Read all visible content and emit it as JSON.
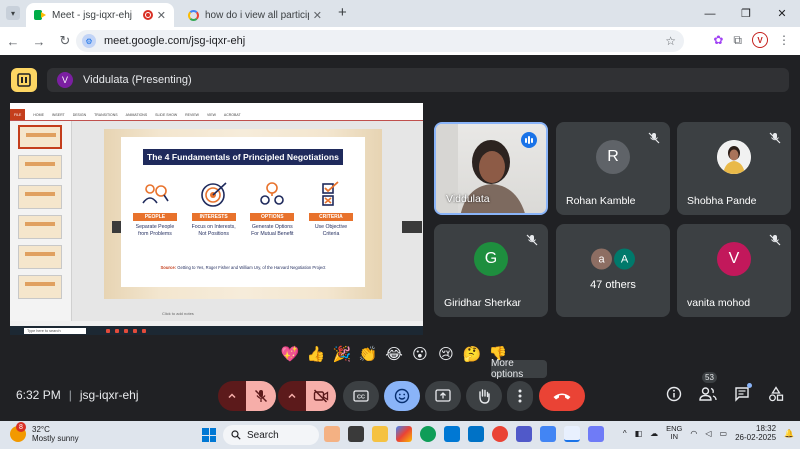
{
  "browser": {
    "tabs": [
      {
        "title": "Meet - jsg-iqxr-ehj"
      },
      {
        "title": "how do i view all participants vi"
      }
    ],
    "url": "meet.google.com/jsg-iqxr-ehj",
    "profile_initial": "V"
  },
  "meet": {
    "presenter": {
      "initial": "V",
      "label": "Viddulata (Presenting)"
    },
    "time": "6:32 PM",
    "separator": "|",
    "meeting_code": "jsg-iqxr-ehj",
    "participant_count": "53",
    "tooltip": "More options",
    "participants": [
      {
        "name": "Viddulata",
        "type": "video",
        "speaking": true
      },
      {
        "name": "Rohan Kamble",
        "initial": "R",
        "color": "#5f6368",
        "muted": true
      },
      {
        "name": "Shobha Pande",
        "type": "photo",
        "muted": true
      },
      {
        "name": "Giridhar Sherkar",
        "initial": "G",
        "color": "#1e8e3e",
        "muted": true
      },
      {
        "name": "47 others",
        "type": "group",
        "initials": [
          "a",
          "A"
        ],
        "colors": [
          "#8d6e63",
          "#00796b"
        ]
      },
      {
        "name": "vanita mohod",
        "initial": "V",
        "color": "#c2185b",
        "muted": true
      }
    ],
    "reactions": [
      "💖",
      "👍",
      "🎉",
      "👏",
      "😂",
      "😮",
      "😢",
      "🤔",
      "👎"
    ]
  },
  "slide": {
    "title": "The 4 Fundamentals of Principled Negotiations",
    "pillars": [
      {
        "label": "PEOPLE",
        "line1": "Separate People",
        "line2": "from Problems"
      },
      {
        "label": "INTERESTS",
        "line1": "Focus on Interests,",
        "line2": "Not Positions"
      },
      {
        "label": "OPTIONS",
        "line1": "Generate Options",
        "line2": "For Mutual Benefit"
      },
      {
        "label": "CRITERIA",
        "line1": "Use Objective",
        "line2": "Criteria"
      }
    ],
    "source_label": "Source:",
    "source_text": "Getting to Yes, Roger Fisher and William Ury, of the Harvard Negotiation Project",
    "notes_hint": "Click to add notes",
    "ribbon_tabs": [
      "FILE",
      "HOME",
      "INSERT",
      "DESIGN",
      "TRANSITIONS",
      "ANIMATIONS",
      "SLIDE SHOW",
      "REVIEW",
      "VIEW",
      "ACROBAT"
    ],
    "search_placeholder": "Type here to search"
  },
  "taskbar": {
    "temperature": "32°C",
    "weather": "Mostly sunny",
    "weather_badge": "8",
    "search": "Search",
    "lang_line1": "ENG",
    "lang_line2": "IN",
    "time": "18:32",
    "date": "26-02-2025"
  },
  "colors": {
    "accent": "#8ab4f8",
    "hangup": "#ea4335",
    "presenting": "#fdd663",
    "slide_orange": "#e8722c",
    "slide_navy": "#1f2a5c"
  }
}
